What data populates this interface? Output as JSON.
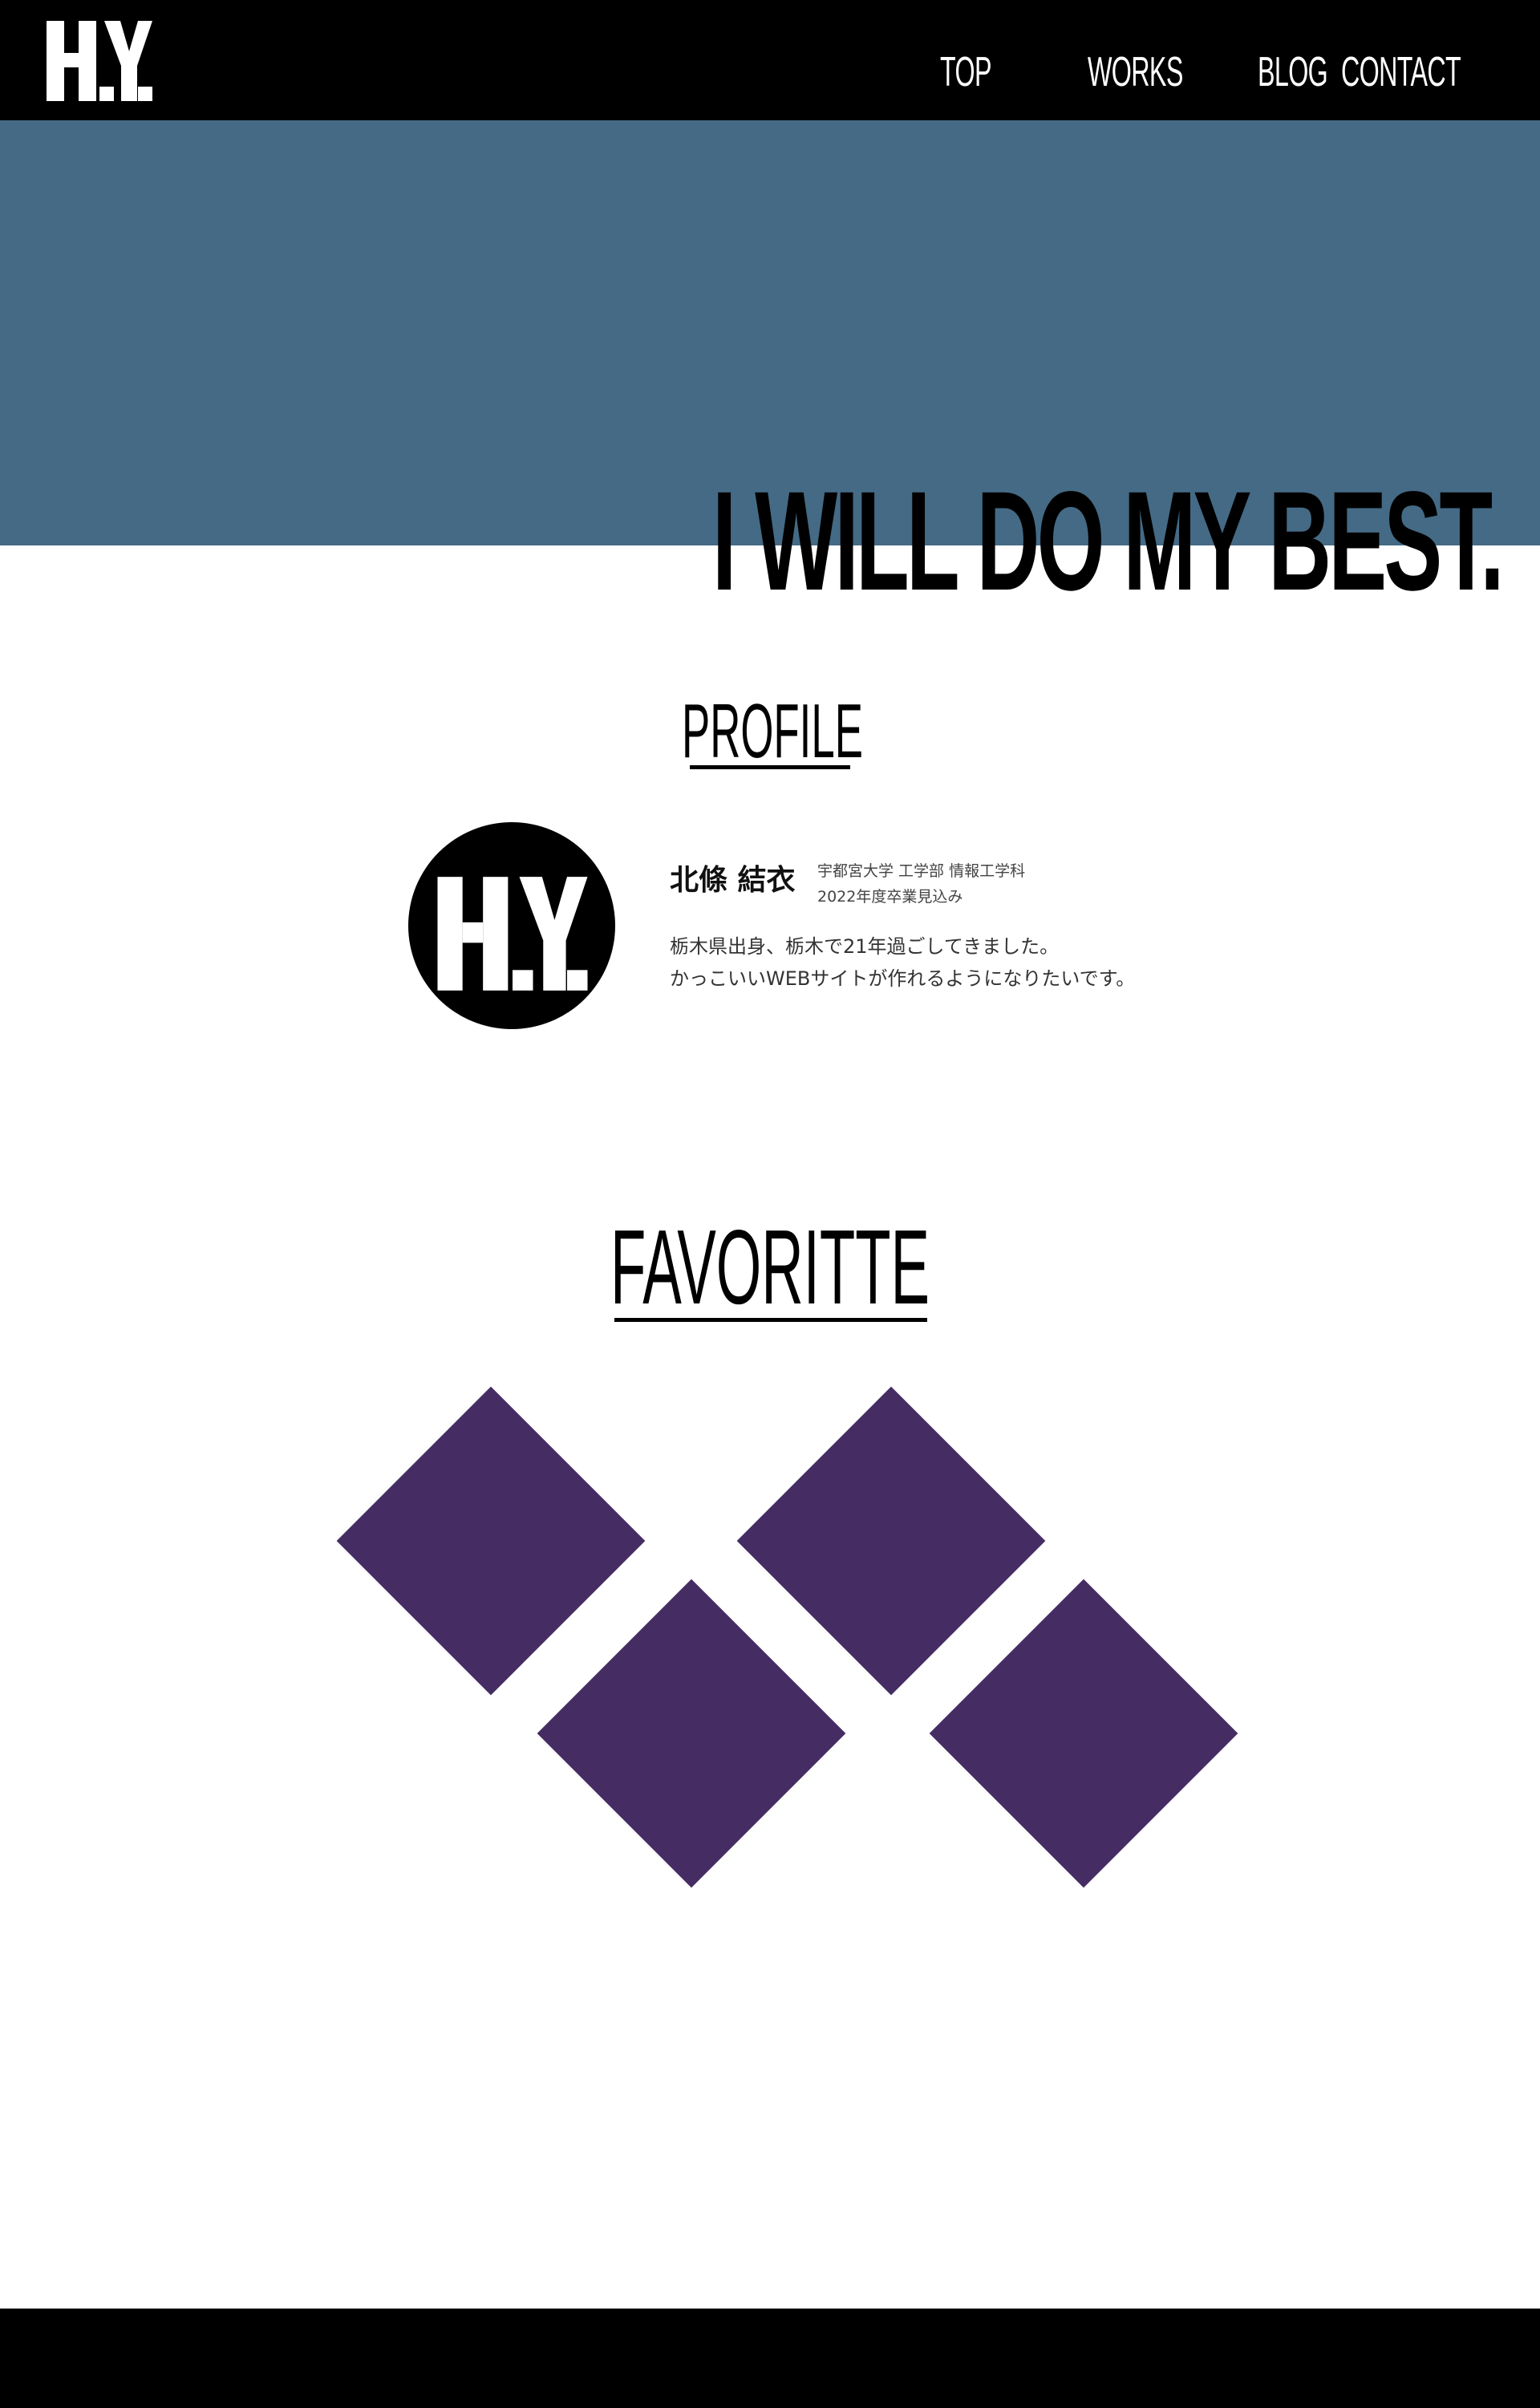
{
  "header": {
    "logo": {
      "text": "H.Y.",
      "icon": "hy-logo"
    },
    "nav": [
      {
        "label": "TOP"
      },
      {
        "label": "WORKS"
      },
      {
        "label": "BLOG"
      },
      {
        "label": "CONTACT"
      }
    ]
  },
  "hero": {
    "tagline": "I WILL DO MY BEST.",
    "background_color": "#446a85"
  },
  "profile": {
    "title": "PROFILE",
    "avatar": {
      "text": "H.Y.",
      "icon": "hy-logo-circle"
    },
    "name": "北條 結衣",
    "affiliation_line1": "宇都宮大学 工学部 情報工学科",
    "affiliation_line2": "2022年度卒業見込み",
    "bio_line1": "栃木県出身、栃木で21年過ごしてきました。",
    "bio_line2": "かっこいいWEBサイトが作れるようになりたいです。"
  },
  "favorite": {
    "title": "FAVORITTE",
    "tile_color": "#452d63",
    "tiles": [
      "diamond-tile",
      "diamond-tile",
      "diamond-tile",
      "diamond-tile"
    ]
  },
  "colors": {
    "header": "#000000",
    "footer": "#000000",
    "accent": "#452d63"
  }
}
